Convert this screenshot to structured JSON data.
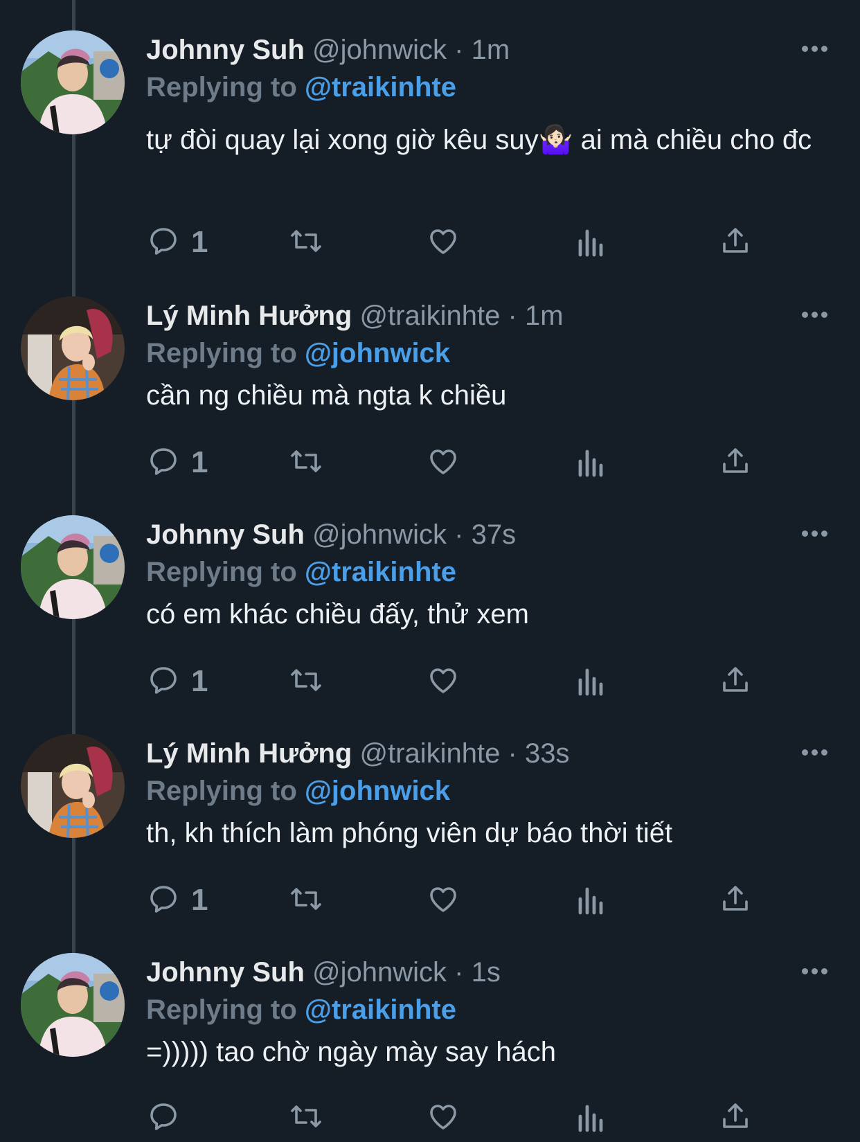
{
  "tweets": [
    {
      "name": "Johnny Suh",
      "handle": "@johnwick",
      "time": "1m",
      "replying_to_label": "Replying to",
      "replying_to": "@traikinhte",
      "text": "tự đòi quay lại xong giờ kêu suy🤷🏻‍♀️  ai mà chiều cho đc",
      "reply_count": "1",
      "avatar": "johnny-avatar"
    },
    {
      "name": "Lý Minh Hưởng",
      "handle": "@traikinhte",
      "time": "1m",
      "replying_to_label": "Replying to",
      "replying_to": "@johnwick",
      "text": "cần ng chiều mà ngta k chiều",
      "reply_count": "1",
      "avatar": "minh-avatar"
    },
    {
      "name": "Johnny Suh",
      "handle": "@johnwick",
      "time": "37s",
      "replying_to_label": "Replying to",
      "replying_to": "@traikinhte",
      "text": "có em khác chiều đấy, thử xem",
      "reply_count": "1",
      "avatar": "johnny-avatar"
    },
    {
      "name": "Lý Minh Hưởng",
      "handle": "@traikinhte",
      "time": "33s",
      "replying_to_label": "Replying to",
      "replying_to": "@johnwick",
      "text": "th, kh thích làm phóng viên dự báo thời tiết",
      "reply_count": "1",
      "avatar": "minh-avatar"
    },
    {
      "name": "Johnny Suh",
      "handle": "@johnwick",
      "time": "1s",
      "replying_to_label": "Replying to",
      "replying_to": "@traikinhte",
      "text": "=))))) tao chờ ngày mày say hách",
      "reply_count": "",
      "avatar": "johnny-avatar"
    }
  ],
  "separator": "·",
  "icons": [
    "reply-icon",
    "retweet-icon",
    "like-icon",
    "analytics-icon",
    "share-icon",
    "more-icon"
  ],
  "colors": {
    "background": "#151d27",
    "accent": "#4a9fe8",
    "muted": "#8b98a5",
    "thread_line": "#38444d"
  }
}
